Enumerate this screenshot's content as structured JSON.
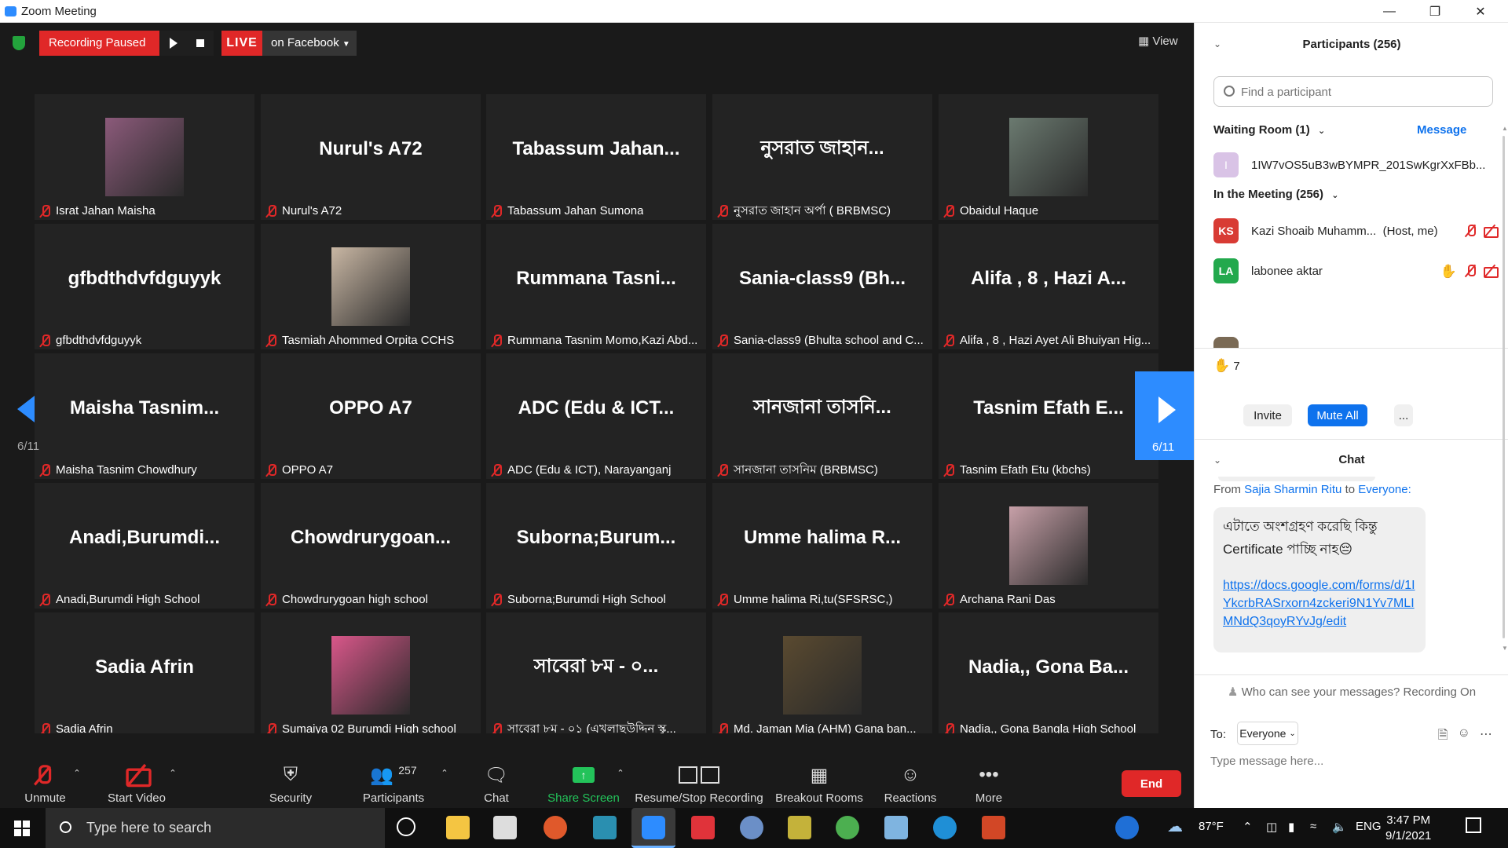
{
  "window": {
    "title": "Zoom Meeting",
    "minimize_icon": "minimize-icon",
    "restore_icon": "restore-icon",
    "close_icon": "close-icon"
  },
  "topbar": {
    "recording_status": "Recording Paused",
    "live_label": "LIVE",
    "live_target": "on Facebook",
    "view_label": "View"
  },
  "tiles": [
    {
      "big": "",
      "name": "Israt Jahan Maisha",
      "photo": "#8b5a7a"
    },
    {
      "big": "Nurul's A72",
      "name": "Nurul's A72"
    },
    {
      "big": "Tabassum  Jahan...",
      "name": "Tabassum Jahan Sumona"
    },
    {
      "big": "নুসরাত জাহান...",
      "name": "নুসরাত জাহান অর্পা ( BRBMSC)"
    },
    {
      "big": "",
      "name": "Obaidul Haque",
      "photo": "#6b7a70"
    },
    {
      "big": "gfbdthdvfdguyyk",
      "name": "gfbdthdvfdguyyk"
    },
    {
      "big": "",
      "name": "Tasmiah Ahommed Orpita CCHS",
      "photo": "#c9b7a4"
    },
    {
      "big": "Rummana  Tasni...",
      "name": "Rummana Tasnim Momo,Kazi Abd..."
    },
    {
      "big": "Sania-class9  (Bh...",
      "name": "Sania-class9 (Bhulta school and C..."
    },
    {
      "big": "Alifa , 8 , Hazi A...",
      "name": "Alifa , 8 , Hazi Ayet Ali Bhuiyan Hig..."
    },
    {
      "big": "Maisha  Tasnim...",
      "name": "Maisha Tasnim Chowdhury"
    },
    {
      "big": "OPPO A7",
      "name": "OPPO A7"
    },
    {
      "big": "ADC (Edu & ICT...",
      "name": "ADC (Edu & ICT), Narayanganj"
    },
    {
      "big": "সানজানা তাসনি...",
      "name": "সানজানা তাসনিম (BRBMSC)"
    },
    {
      "big": "Tasnim  Efath  E...",
      "name": "Tasnim  Efath  Etu (kbchs)"
    },
    {
      "big": "Anadi,Burumdi...",
      "name": "Anadi,Burumdi High School"
    },
    {
      "big": "Chowdrurygoan...",
      "name": "Chowdrurygoan high school"
    },
    {
      "big": "Suborna;Burum...",
      "name": "Suborna;Burumdi High School"
    },
    {
      "big": "Umme  halima  R...",
      "name": "Umme halima Ri,tu(SFSRSC,)"
    },
    {
      "big": "",
      "name": "Archana Rani Das",
      "photo": "#c7a0a8"
    },
    {
      "big": "Sadia Afrin",
      "name": "Sadia Afrin"
    },
    {
      "big": "",
      "name": "Sumaiya 02 Burumdi High school",
      "photo": "#d9578a"
    },
    {
      "big": "সাবেরা  ৮ম  - ০...",
      "name": "সাবেরা  ৮ম  - ০১ (এখলাছউদ্দিন স্কু..."
    },
    {
      "big": "",
      "name": "Md. Jaman Mia  (AHM)  Gana ban...",
      "photo": "#5a4a30"
    },
    {
      "big": "Nadia,, Gona  Ba...",
      "name": "Nadia,, Gona Bangla High School"
    }
  ],
  "nav": {
    "left_page": "6/11",
    "right_page": "6/11"
  },
  "toolbar": {
    "unmute": "Unmute",
    "start_video": "Start Video",
    "security": "Security",
    "participants": "Participants",
    "participants_count": "257",
    "chat": "Chat",
    "share_screen": "Share Screen",
    "recording": "Resume/Stop Recording",
    "breakout": "Breakout Rooms",
    "reactions": "Reactions",
    "more": "More",
    "end": "End"
  },
  "participants_panel": {
    "title": "Participants (256)",
    "search_placeholder": "Find a participant",
    "waiting_room": "Waiting Room (1)",
    "message_link": "Message",
    "waiting": [
      {
        "initial": "I",
        "name": "1IW7vOS5uB3wBYMPR_201SwKgrXxFBb...",
        "color": "#d9c3e6"
      }
    ],
    "in_meeting": "In the Meeting (256)",
    "members": [
      {
        "initials": "KS",
        "name": "Kazi Shoaib Muhamm...",
        "tag": "(Host, me)",
        "color": "#d83b34"
      },
      {
        "initials": "LA",
        "name": "labonee aktar",
        "tag": "",
        "color": "#23a94d"
      }
    ],
    "raised_hands": "7",
    "invite": "Invite",
    "mute_all": "Mute All",
    "more": "..."
  },
  "chat": {
    "title": "Chat",
    "from_prefix": "From",
    "sender": "Sajia Sharmin Ritu",
    "to_word": "to",
    "recipient": "Everyone:",
    "message_text": "এটাতে অংশগ্রহণ করেছি কিন্তু Certificate পাচ্ছি নাহ😔",
    "message_link": "https://docs.google.com/forms/d/1IYkcrbRASrxorn4zckeri9N1Yv7MLIMNdQ3qoyRYvJg/edit",
    "who_can_see": "Who can see your messages? Recording On",
    "to_label": "To:",
    "to_value": "Everyone",
    "input_placeholder": "Type message here..."
  },
  "taskbar": {
    "search_text": "Type here to search",
    "temperature": "87°F",
    "language": "ENG",
    "time": "3:47 PM",
    "date": "9/1/2021"
  },
  "colors": {
    "accent": "#2d8cff",
    "red": "#e02828",
    "link": "#0e72ed"
  }
}
